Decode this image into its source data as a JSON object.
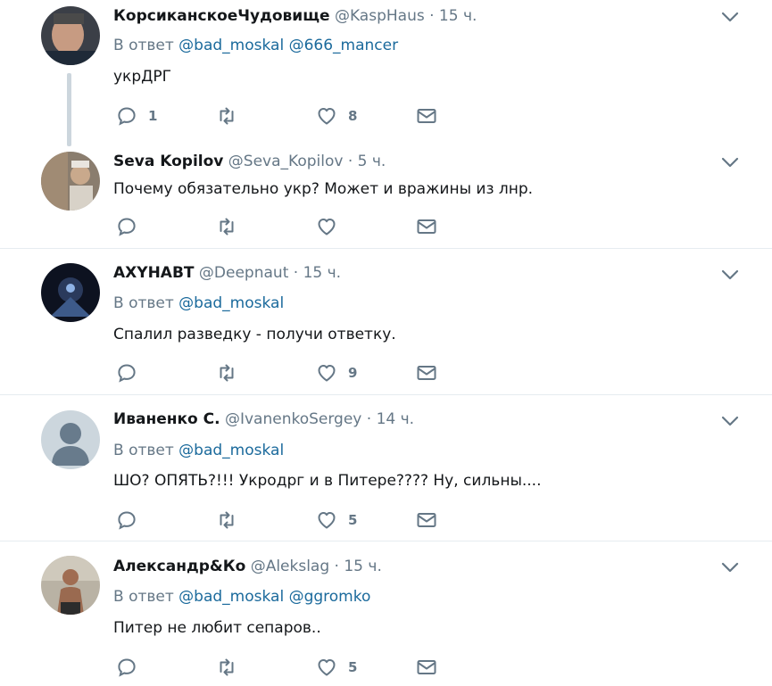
{
  "tweets": [
    {
      "name": "КорсиканскоеЧудовище",
      "handle": "@KaspHaus",
      "dot": "·",
      "time": "15 ч.",
      "reply_prefix": "В ответ",
      "reply_mentions": "@bad_moskal @666_mancer",
      "text": "укрДРГ",
      "replies": "1",
      "retweets": "",
      "likes": "8"
    },
    {
      "name": "Seva Kopilov",
      "handle": "@Seva_Kopilov",
      "dot": "·",
      "time": "5 ч.",
      "text": "Почему обязательно укр? Может и вражины из лнр.",
      "replies": "",
      "retweets": "",
      "likes": ""
    },
    {
      "name": "AXYHABT",
      "handle": "@Deepnaut",
      "dot": "·",
      "time": "15 ч.",
      "reply_prefix": "В ответ",
      "reply_mentions": "@bad_moskal",
      "text": "Спалил разведку - получи ответку.",
      "replies": "",
      "retweets": "",
      "likes": "9"
    },
    {
      "name": "Иваненко С.",
      "handle": "@IvanenkoSergey",
      "dot": "·",
      "time": "14 ч.",
      "reply_prefix": "В ответ",
      "reply_mentions": "@bad_moskal",
      "text": "ШО? ОПЯТЬ?!!! Укродрг и в Питере???? Ну, сильны....",
      "replies": "",
      "retweets": "",
      "likes": "5"
    },
    {
      "name": "Александр&Ко",
      "handle": "@Alekslag",
      "dot": "·",
      "time": "15 ч.",
      "reply_prefix": "В ответ",
      "reply_mentions": "@bad_moskal @ggromko",
      "text": "Питер не любит сепаров..",
      "replies": "",
      "retweets": "",
      "likes": "5"
    }
  ],
  "icons": {
    "reply": "reply-icon",
    "retweet": "retweet-icon",
    "like": "heart-icon",
    "dm": "envelope-icon",
    "more": "chevron-down-icon"
  },
  "colors": {
    "text": "#14171a",
    "secondary": "#657786",
    "mention": "#1b6a9c",
    "separator": "#e6ecf0",
    "thread_line": "#ccd6dd"
  }
}
